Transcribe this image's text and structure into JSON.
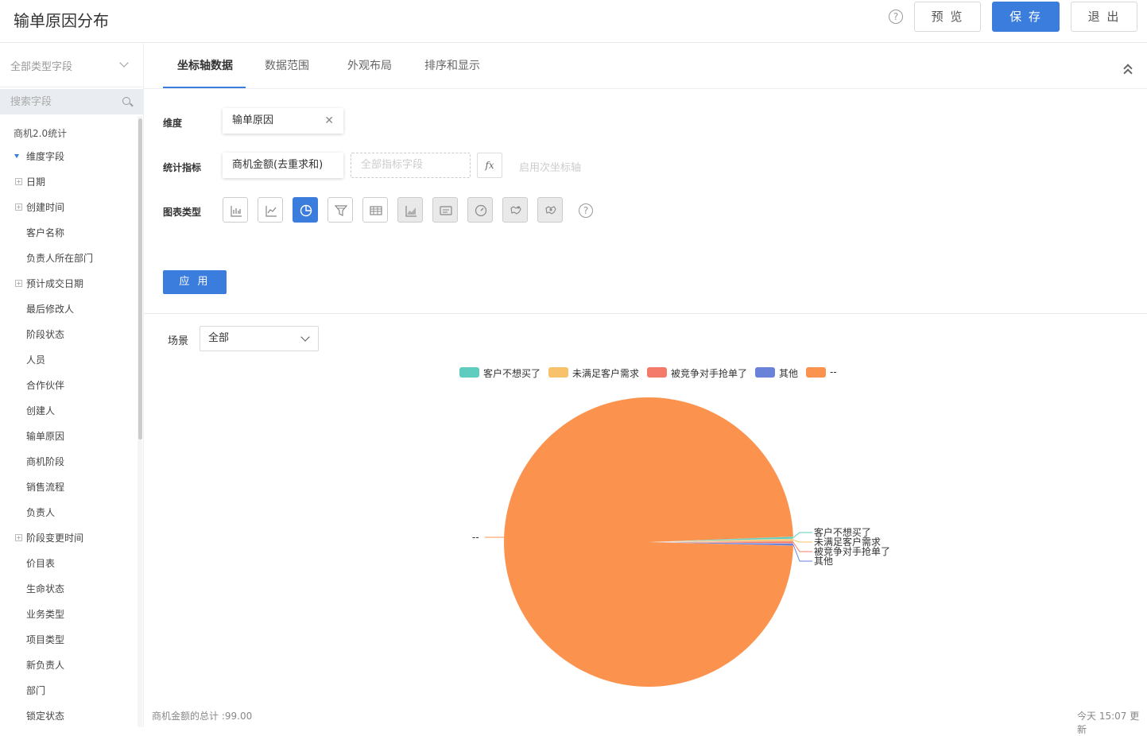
{
  "header": {
    "title": "输单原因分布",
    "help_icon": "?",
    "preview_label": "预 览",
    "save_label": "保 存",
    "exit_label": "退 出"
  },
  "sidebar": {
    "field_type_select": "全部类型字段",
    "search_placeholder": "搜索字段",
    "root": "商机2.0统计",
    "group": "维度字段",
    "items": [
      {
        "label": "日期",
        "expandable": true
      },
      {
        "label": "创建时间",
        "expandable": true
      },
      {
        "label": "客户名称",
        "expandable": false
      },
      {
        "label": "负责人所在部门",
        "expandable": false
      },
      {
        "label": "预计成交日期",
        "expandable": true
      },
      {
        "label": "最后修改人",
        "expandable": false
      },
      {
        "label": "阶段状态",
        "expandable": false
      },
      {
        "label": "人员",
        "expandable": false
      },
      {
        "label": "合作伙伴",
        "expandable": false
      },
      {
        "label": "创建人",
        "expandable": false
      },
      {
        "label": "输单原因",
        "expandable": false
      },
      {
        "label": "商机阶段",
        "expandable": false
      },
      {
        "label": "销售流程",
        "expandable": false
      },
      {
        "label": "负责人",
        "expandable": false
      },
      {
        "label": "阶段变更时间",
        "expandable": true
      },
      {
        "label": "价目表",
        "expandable": false
      },
      {
        "label": "生命状态",
        "expandable": false
      },
      {
        "label": "业务类型",
        "expandable": false
      },
      {
        "label": "项目类型",
        "expandable": false
      },
      {
        "label": "新负责人",
        "expandable": false
      },
      {
        "label": "部门",
        "expandable": false
      },
      {
        "label": "锁定状态",
        "expandable": false
      }
    ]
  },
  "tabs": [
    "坐标轴数据",
    "数据范围",
    "外观布局",
    "排序和显示"
  ],
  "active_tab": 0,
  "config": {
    "dimension_label": "维度",
    "dimension_value": "输单原因",
    "metric_label": "统计指标",
    "metric_value": "商机金额(去重求和)",
    "metric_placeholder": "全部指标字段",
    "fx_label": "fx",
    "secondary_axis": "启用次坐标轴",
    "chart_type_label": "图表类型",
    "chart_types": [
      {
        "icon": "bar-chart-icon",
        "state": "normal"
      },
      {
        "icon": "line-chart-icon",
        "state": "normal"
      },
      {
        "icon": "pie-chart-icon",
        "state": "selected"
      },
      {
        "icon": "funnel-chart-icon",
        "state": "normal"
      },
      {
        "icon": "table-icon",
        "state": "normal"
      },
      {
        "icon": "area-chart-icon",
        "state": "disabled"
      },
      {
        "icon": "card-icon",
        "state": "disabled"
      },
      {
        "icon": "gauge-icon",
        "state": "disabled"
      },
      {
        "icon": "map-icon",
        "state": "disabled"
      },
      {
        "icon": "map-pin-icon",
        "state": "disabled"
      }
    ],
    "apply_label": "应 用"
  },
  "filter": {
    "scene_label": "场景",
    "scene_value": "全部"
  },
  "chart_data": {
    "type": "pie",
    "categories": [
      "客户不想买了",
      "未满足客户需求",
      "被竞争对手抢单了",
      "其他",
      "--"
    ],
    "values": [
      0.25,
      0.25,
      0.25,
      0.25,
      98.0
    ],
    "colors": [
      "#5ecdc0",
      "#f7c26a",
      "#f47b6a",
      "#6a82d8",
      "#fb934e"
    ],
    "legend_position": "top-center"
  },
  "footer": {
    "total": "商机金额的总计 :99.00",
    "updated": "今天 15:07 更新"
  }
}
